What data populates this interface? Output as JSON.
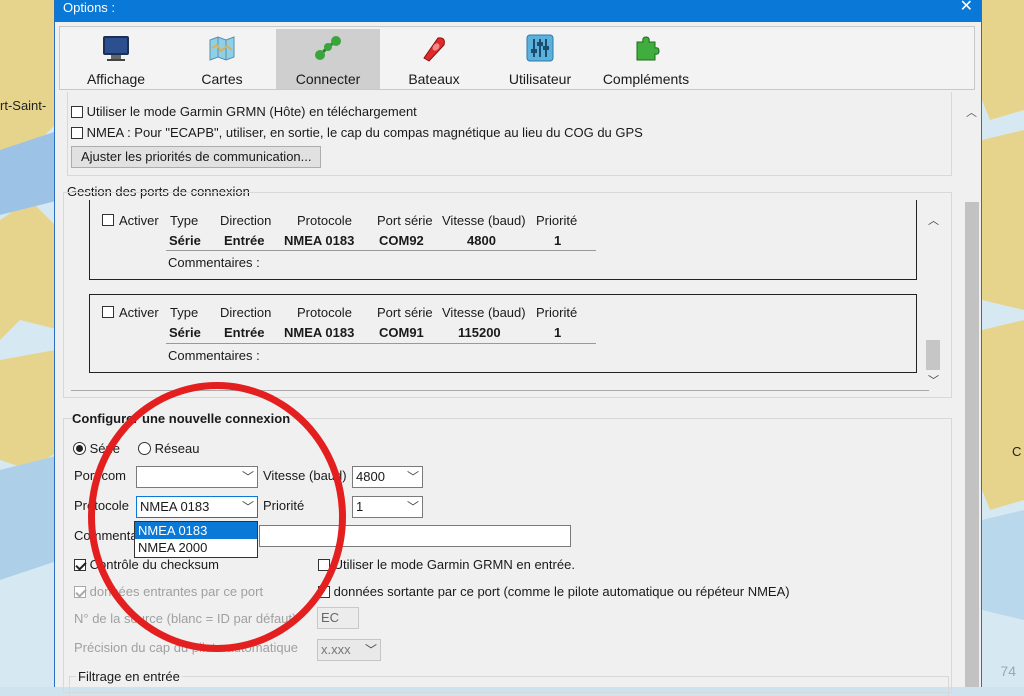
{
  "map": {
    "label_left": "rt-Saint-",
    "label_right": "C",
    "zoom_text": "74"
  },
  "dialog": {
    "title": "Options :",
    "close_glyph": "✕",
    "tabs": [
      {
        "label": "Affichage",
        "icon": "monitor-icon"
      },
      {
        "label": "Cartes",
        "icon": "map-icon"
      },
      {
        "label": "Connecter",
        "icon": "connect-icon",
        "selected": true
      },
      {
        "label": "Bateaux",
        "icon": "boat-icon"
      },
      {
        "label": "Utilisateur",
        "icon": "sliders-icon"
      },
      {
        "label": "Compléments",
        "icon": "puzzle-icon"
      }
    ]
  },
  "general": {
    "garmin_host": "Utiliser le mode Garmin GRMN (Hôte) en téléchargement",
    "nmea_ecapb": "NMEA : Pour \"ECAPB\", utiliser, en sortie, le cap du compas magnétique  au lieu du COG du GPS",
    "priorities_button": "Ajuster les priorités de communication..."
  },
  "ports": {
    "section_label": "Gestion des ports de connexion",
    "headers": {
      "activate": "Activer",
      "type": "Type",
      "direction": "Direction",
      "protocol": "Protocole",
      "port": "Port série",
      "speed": "Vitesse (baud)",
      "priority": "Priorité"
    },
    "comments_label": "Commentaires :",
    "items": [
      {
        "type": "Série",
        "direction": "Entrée",
        "protocol": "NMEA 0183",
        "port": "COM92",
        "speed": "4800",
        "priority": "1"
      },
      {
        "type": "Série",
        "direction": "Entrée",
        "protocol": "NMEA 0183",
        "port": "COM91",
        "speed": "115200",
        "priority": "1"
      }
    ]
  },
  "new_connection": {
    "heading": "Configurer une nouvelle connexion",
    "serial_label": "Série",
    "network_label": "Réseau",
    "port_com_label": "Port com",
    "port_com_value": "",
    "speed_label": "Vitesse (baud)",
    "speed_value": "4800",
    "protocol_label": "Protocole",
    "protocol_value": "NMEA 0183",
    "protocol_options": [
      "NMEA 0183",
      "NMEA 2000"
    ],
    "priority_label": "Priorité",
    "priority_value": "1",
    "comment_label": "Commentaire",
    "comment_value": "",
    "checksum_label": "Contrôle du checksum",
    "garmin_input_label": "Utiliser le mode Garmin GRMN en entrée.",
    "incoming_label": "données entrantes par ce port",
    "outgoing_label": "données sortante par ce port (comme le pilote automatique ou répéteur NMEA)",
    "source_id_label": "N° de la source (blanc = ID par défaut)",
    "source_id_value": "EC",
    "autopilot_precision_label": "Précision du cap du pilote automatique",
    "autopilot_precision_value": "x.xxx",
    "filter_label": "Filtrage en entrée"
  },
  "colors": {
    "titlebar": "#0a78d7",
    "annotation_circle": "#e3201f",
    "selected_option": "#0a78d7"
  }
}
